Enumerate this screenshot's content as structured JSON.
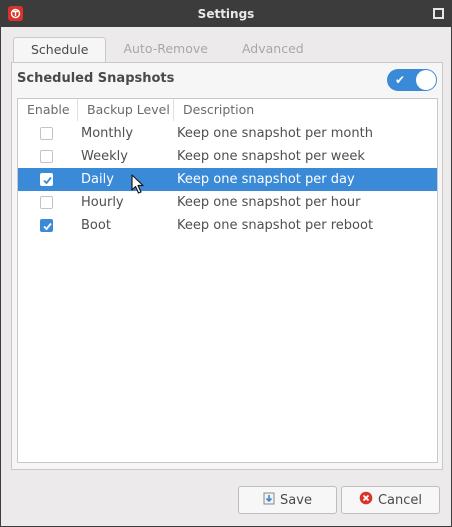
{
  "window": {
    "title": "Settings"
  },
  "tabs": [
    {
      "label": "Schedule",
      "active": true
    },
    {
      "label": "Auto-Remove",
      "active": false
    },
    {
      "label": "Advanced",
      "active": false
    }
  ],
  "section": {
    "title": "Scheduled Snapshots",
    "toggle_on": true
  },
  "list": {
    "columns": [
      "Enable",
      "Backup Level",
      "Description"
    ],
    "rows": [
      {
        "enabled": false,
        "level": "Monthly",
        "description": "Keep one snapshot per month",
        "selected": false
      },
      {
        "enabled": false,
        "level": "Weekly",
        "description": "Keep one snapshot per week",
        "selected": false
      },
      {
        "enabled": true,
        "level": "Daily",
        "description": "Keep one snapshot per day",
        "selected": true
      },
      {
        "enabled": false,
        "level": "Hourly",
        "description": "Keep one snapshot per hour",
        "selected": false
      },
      {
        "enabled": true,
        "level": "Boot",
        "description": "Keep one snapshot per reboot",
        "selected": false
      }
    ]
  },
  "buttons": {
    "save_label": "Save",
    "cancel_label": "Cancel"
  },
  "colors": {
    "accent": "#3b8ad8",
    "titlebar": "#3c3c3c",
    "app_icon": "#d9332b",
    "cancel_icon": "#d9332b"
  }
}
